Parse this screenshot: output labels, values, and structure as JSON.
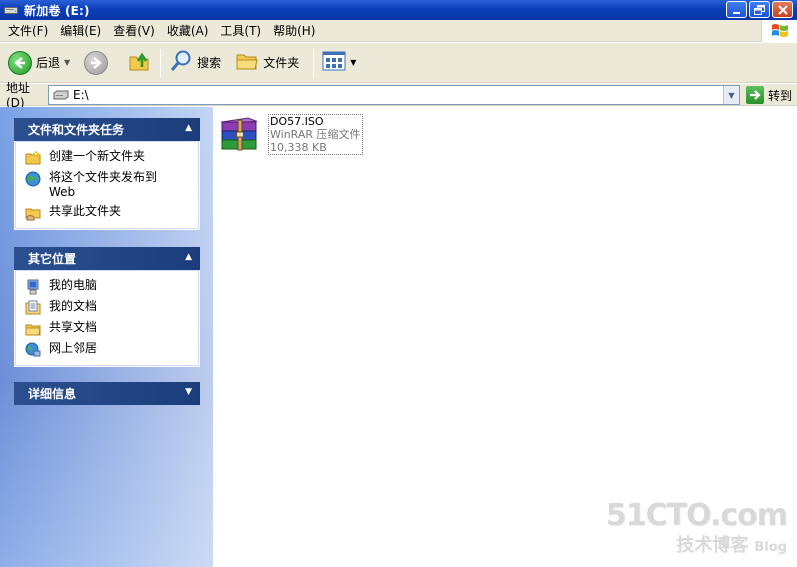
{
  "window": {
    "title": "新加卷 (E:)",
    "controls": [
      "minimize",
      "maximize",
      "close"
    ]
  },
  "menu": [
    {
      "label": "文件(F)"
    },
    {
      "label": "编辑(E)"
    },
    {
      "label": "查看(V)"
    },
    {
      "label": "收藏(A)"
    },
    {
      "label": "工具(T)"
    },
    {
      "label": "帮助(H)"
    }
  ],
  "toolbar": {
    "back_label": "后退",
    "search_label": "搜索",
    "folders_label": "文件夹"
  },
  "address": {
    "label": "地址(D)",
    "value": "E:\\",
    "go_label": "转到"
  },
  "tasks_panel": {
    "title": "文件和文件夹任务",
    "items": [
      {
        "label": "创建一个新文件夹",
        "icon": "new-folder-icon"
      },
      {
        "label": "将这个文件夹发布到\nWeb",
        "icon": "publish-web-icon"
      },
      {
        "label": "共享此文件夹",
        "icon": "share-folder-icon"
      }
    ]
  },
  "places_panel": {
    "title": "其它位置",
    "items": [
      {
        "label": "我的电脑",
        "icon": "my-computer-icon"
      },
      {
        "label": "我的文档",
        "icon": "my-documents-icon"
      },
      {
        "label": "共享文档",
        "icon": "shared-documents-icon"
      },
      {
        "label": "网上邻居",
        "icon": "network-places-icon"
      }
    ]
  },
  "details_panel": {
    "title": "详细信息"
  },
  "files": [
    {
      "name": "DO57.ISO",
      "type": "WinRAR 压缩文件",
      "size": "10,338 KB"
    }
  ],
  "watermark": {
    "main": "51CTO.com",
    "sub": "技术博客",
    "sub2": "Blog"
  },
  "colors": {
    "titlebar": "#0a3fb8",
    "panel_header": "#1c3d7c",
    "chrome": "#ece9d8"
  }
}
